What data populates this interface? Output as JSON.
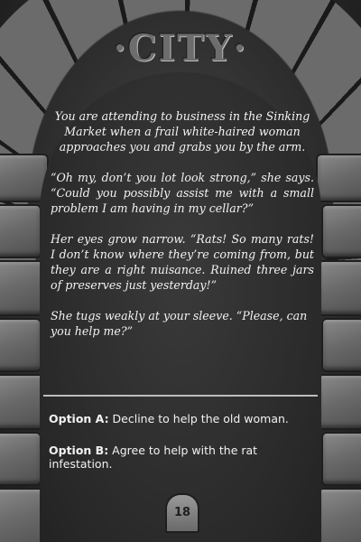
{
  "title": "·CITY·",
  "story": {
    "p1": "You are attending to business in the Sinking Market when a frail white-haired woman approaches you and grabs you by the arm.",
    "p2": "“Oh my, don’t you lot look strong,” she says. “Could you possibly assist me with a small problem I am having in my cellar?”",
    "p3": "Her eyes grow narrow. “Rats! So many rats! I don’t know where they’re coming from, but they are a right nuisance. Ruined three jars of preserves just yesterday!”",
    "p4": "She tugs weakly at your sleeve. “Please, can you help me?”"
  },
  "options": {
    "a_label": "Option A:",
    "a_text": " Decline to help the old woman.",
    "b_label": "Option B:",
    "b_text": " Agree to help with the rat infestation."
  },
  "page_number": "18"
}
